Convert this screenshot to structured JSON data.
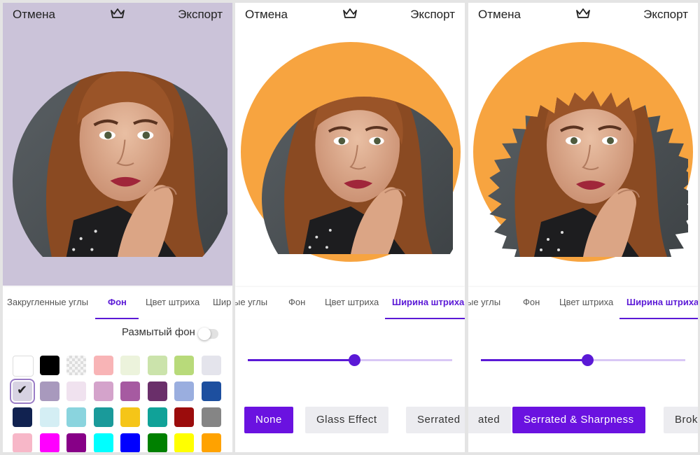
{
  "topbar": {
    "cancel_label": "Отмена",
    "export_label": "Экспорт"
  },
  "panel1": {
    "tabs": [
      "Закругленные углы",
      "Фон",
      "Цвет штриха",
      "Шир"
    ],
    "active_tab": "Фон",
    "blur_label": "Размытый фон",
    "blur_enabled": false,
    "selected_swatch": 8,
    "swatches": [
      "#ffffff",
      "#000000",
      "transparent",
      "#f8b4b6",
      "#ecf3dc",
      "#cbe3ab",
      "#b8da7a",
      "#e4e4ec",
      "#d7d2e2",
      "#a899bd",
      "#f0e2ef",
      "#d4a3cb",
      "#a65aa1",
      "#6a2f6a",
      "#9aaedf",
      "#1d4f9f",
      "#112250",
      "#d4eef4",
      "#8ad4de",
      "#1a9a9a",
      "#f5c518",
      "#10a298",
      "#9b0c0c",
      "#858585",
      "#f7b7c8",
      "#ff00ff",
      "#870087",
      "#00ffff",
      "#0000ff",
      "#008000",
      "#ffff00",
      "#ffa200"
    ]
  },
  "panel2": {
    "tabs": [
      "ые углы",
      "Фон",
      "Цвет штриха",
      "Ширина штриха"
    ],
    "active_tab": "Ширина штриха",
    "slider_value": 0.52,
    "styles": [
      "None",
      "Glass Effect",
      "Serrated"
    ],
    "active_style": "None",
    "ring_color": "#f7a440"
  },
  "panel3": {
    "tabs": [
      "ые углы",
      "Фон",
      "Цвет штриха",
      "Ширина штриха"
    ],
    "active_tab": "Ширина штриха",
    "slider_value": 0.52,
    "styles": [
      "ated",
      "Serrated & Sharpness",
      "Brok"
    ],
    "active_style": "Serrated & Sharpness",
    "ring_color": "#f7a440"
  },
  "colors": {
    "accent": "#5b19d6",
    "background_lavender": "#cbc3d9"
  },
  "icons": {
    "crown": "crown-icon",
    "check": "check-icon"
  }
}
